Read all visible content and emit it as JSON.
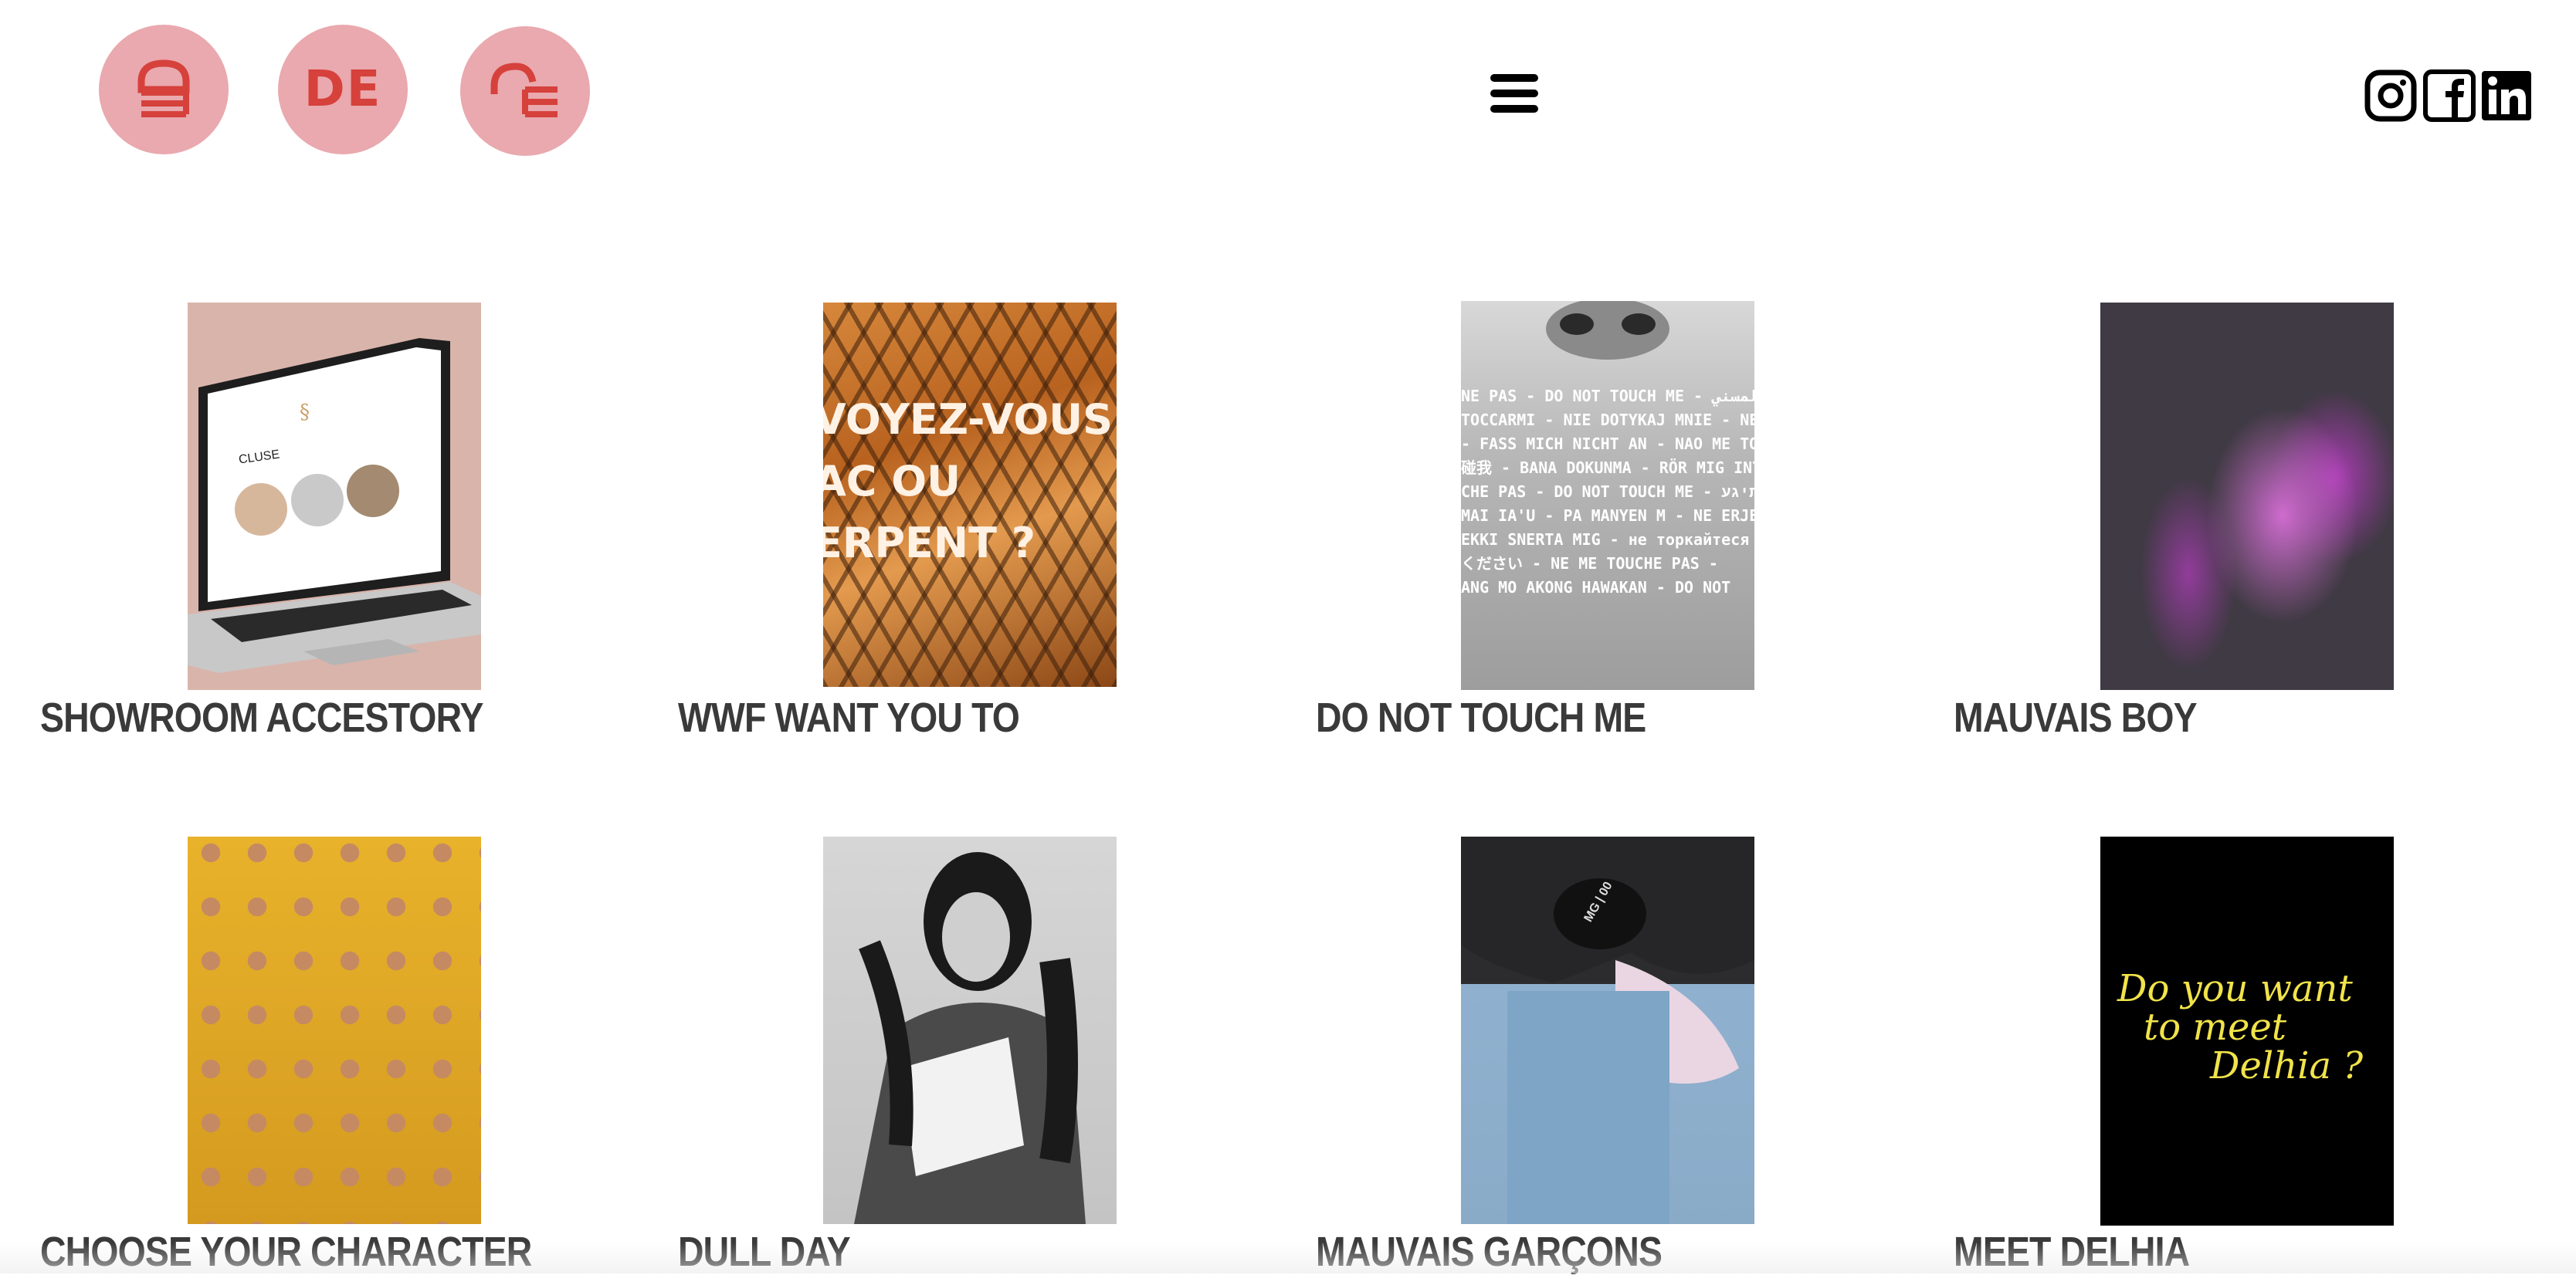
{
  "header": {
    "logos": [
      {
        "label": "DE",
        "icon": "de-logo-flipped-icon"
      },
      {
        "label": "DE",
        "icon": "de-logo-icon"
      },
      {
        "label": "DE",
        "icon": "de-logo-rotated-icon"
      }
    ],
    "menu_icon": "hamburger-menu-icon",
    "social": [
      "instagram-icon",
      "facebook-icon",
      "linkedin-icon"
    ],
    "colors": {
      "logo_bg": "#e9a9ae",
      "logo_fg": "#d6413c"
    }
  },
  "projects": [
    {
      "title": "SHOWROOM ACCESTORY",
      "thumb_text": "CLUSE"
    },
    {
      "title": "WWF WANT YOU TO",
      "thumb_lines": [
        "VOYEZ-VOUS ?",
        "AC OU",
        "ERPENT ?"
      ]
    },
    {
      "title": "DO NOT TOUCH ME",
      "thumb_lines": [
        "NE PAS - DO NOT TOUCH ME - لا تلمسني",
        "TOCCARMI - NIE DOTYKAJ MNIE - NE",
        "- FASS MICH NICHT AN - NAO ME TOQUE",
        "碰我 - BANA DOKUNMA - RÖR MIG INTE",
        "CHE PAS - DO NOT TOUCH ME - אל תיגע",
        "MAI IA'U - PA MANYEN M - NE ERJEN HOZZÁ",
        "EKKI SNERTA MIG - не торкайтеся",
        "ください - NE ME TOUCHE PAS -",
        "ANG MO AKONG HAWAKAN - DO NOT"
      ]
    },
    {
      "title": "MAUVAIS BOY"
    },
    {
      "title": "CHOOSE YOUR CHARACTER"
    },
    {
      "title": "DULL DAY"
    },
    {
      "title": "MAUVAIS GARÇONS",
      "thumb_text": "MG | 00"
    },
    {
      "title": "MEET DELHIA",
      "thumb_lines": [
        "Do you want",
        "to meet",
        "Delhia ?"
      ]
    }
  ]
}
